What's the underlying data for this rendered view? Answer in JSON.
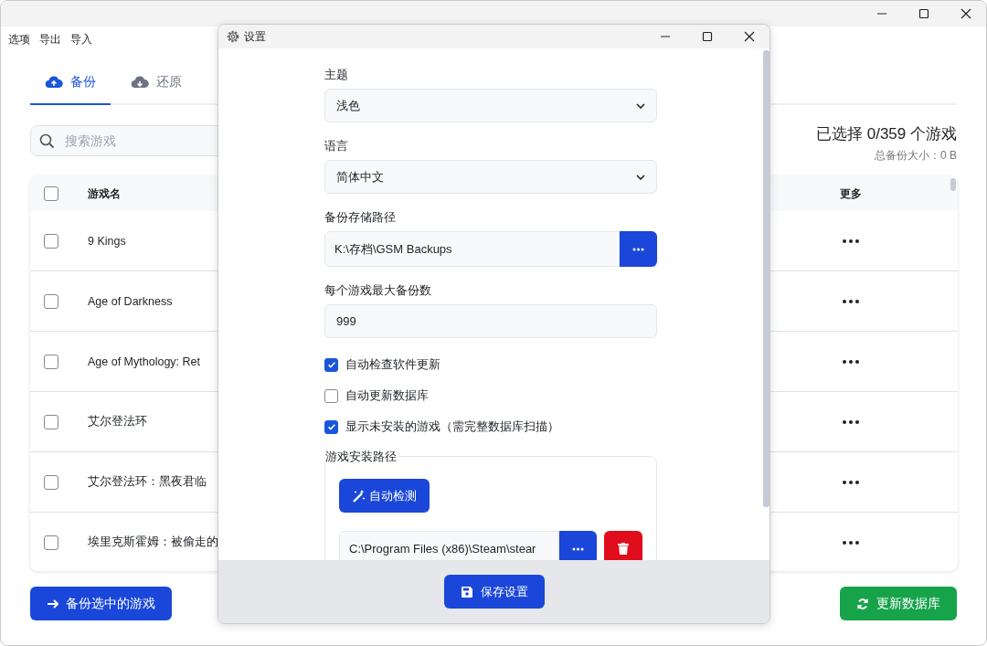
{
  "menu": [
    "选项",
    "导出",
    "导入"
  ],
  "tabs": [
    {
      "label": "备份",
      "kind": "upload",
      "selected": true
    },
    {
      "label": "还原",
      "kind": "download",
      "selected": false
    }
  ],
  "search": {
    "placeholder": "搜索游戏"
  },
  "summary": {
    "selected": "已选择 0/359 个游戏",
    "size": "总备份大小：0 B"
  },
  "table": {
    "columns": [
      "游戏名",
      "更多"
    ],
    "all_checked": false,
    "rows": [
      {
        "name": "9 Kings",
        "checked": false
      },
      {
        "name": "Age of Darkness",
        "checked": false
      },
      {
        "name": "Age of Mythology: Ret",
        "checked": false
      },
      {
        "name": "艾尔登法环",
        "checked": false
      },
      {
        "name": "艾尔登法环：黑夜君临",
        "checked": false
      },
      {
        "name": "埃里克斯霍姆：被偷走的",
        "checked": false
      }
    ]
  },
  "actions": [
    {
      "label": "备份选中的游戏",
      "kind": "backup"
    },
    {
      "label": "更新数据库",
      "kind": "refresh"
    }
  ],
  "dialog": {
    "title": "设置",
    "fields": [
      {
        "kind": "select",
        "label": "主题",
        "value": "浅色"
      },
      {
        "kind": "select",
        "label": "语言",
        "value": "简体中文"
      },
      {
        "kind": "path",
        "label": "备份存储路径",
        "value": "K:\\存档\\GSM Backups"
      },
      {
        "kind": "text",
        "label": "每个游戏最大备份数",
        "value": "999"
      }
    ],
    "options": [
      {
        "label": "自动检查软件更新",
        "checked": true
      },
      {
        "label": "自动更新数据库",
        "checked": false
      },
      {
        "label": "显示未安装的游戏（需完整数据库扫描）",
        "checked": true
      }
    ],
    "install_paths": {
      "legend": "游戏安装路径",
      "detect_button": "自动检测",
      "paths": [
        "C:\\Program Files (x86)\\Steam\\stear"
      ]
    },
    "save_button": "保存设置"
  }
}
